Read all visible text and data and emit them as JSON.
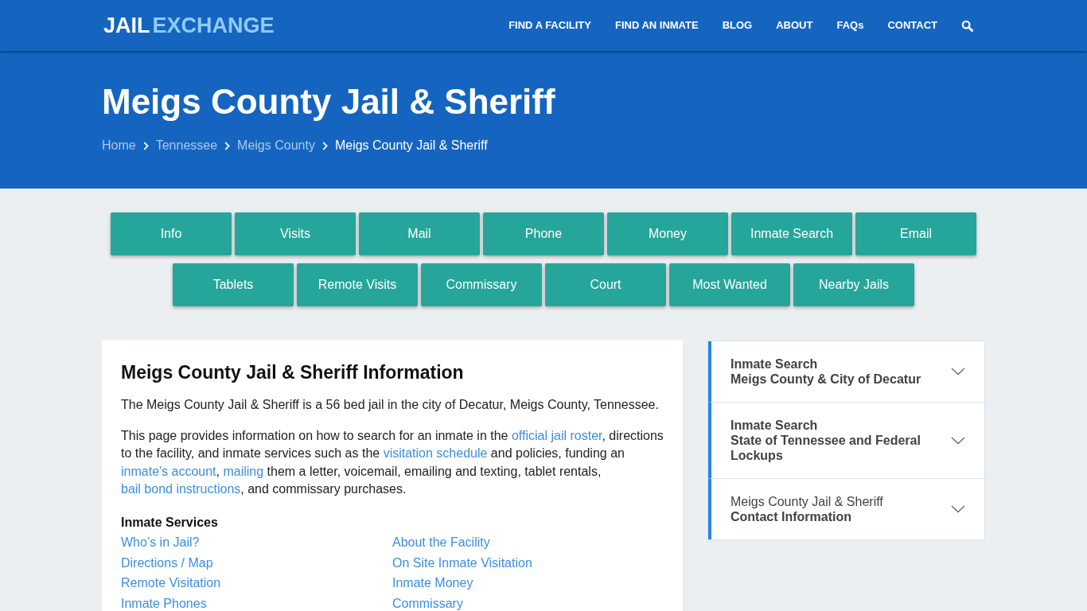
{
  "header": {
    "logo": {
      "part_1": "JAIL",
      "part_2": "EXCHANGE"
    },
    "nav": [
      "FIND A FACILITY",
      "FIND AN INMATE",
      "BLOG",
      "ABOUT",
      "FAQs",
      "CONTACT"
    ]
  },
  "hero": {
    "title": "Meigs County Jail & Sheriff",
    "breadcrumb": [
      {
        "label": "Home",
        "current": false
      },
      {
        "label": "Tennessee",
        "current": false
      },
      {
        "label": "Meigs County",
        "current": false
      },
      {
        "label": "Meigs County Jail & Sheriff",
        "current": true
      }
    ]
  },
  "section_buttons": [
    {
      "buttons": [
        "Info",
        "Visits",
        "Mail",
        "Phone",
        "Money",
        "Inmate Search",
        "Email"
      ]
    },
    {
      "buttons": [
        "Tablets",
        "Remote Visits",
        "Commissary",
        "Court",
        "Most Wanted",
        "Nearby Jails"
      ]
    }
  ],
  "info_card": {
    "heading": "Meigs County Jail & Sheriff Information",
    "paragraphs": [
      [
        {
          "kind": "text",
          "text": "The Meigs County Jail & Sheriff is a 56 bed jail in the city of Decatur, Meigs County, Tennessee."
        }
      ],
      [
        {
          "kind": "text",
          "text": "This page provides information on how to search for an inmate in the "
        },
        {
          "kind": "link",
          "text": "official jail roster"
        },
        {
          "kind": "text",
          "text": ", directions to the facility, and inmate services such as the "
        },
        {
          "kind": "link",
          "text": "visitation schedule"
        },
        {
          "kind": "text",
          "text": " and policies, funding an "
        },
        {
          "kind": "link",
          "text": "inmate's account"
        },
        {
          "kind": "text",
          "text": ", "
        },
        {
          "kind": "link",
          "text": "mailing"
        },
        {
          "kind": "text",
          "text": " them a letter, voicemail, emailing and texting, tablet rentals, "
        },
        {
          "kind": "link",
          "text": "bail bond instructions"
        },
        {
          "kind": "text",
          "text": ", and commissary purchases."
        }
      ]
    ],
    "services": {
      "heading": "Inmate Services",
      "columns": [
        [
          "Who’s in Jail?",
          "Directions / Map",
          "Remote Visitation",
          "Inmate Phones"
        ],
        [
          "About the Facility",
          "On Site Inmate Visitation",
          "Inmate Money",
          "Commissary"
        ]
      ]
    }
  },
  "sidebar": {
    "items": [
      {
        "lines": [
          {
            "text": "Inmate Search",
            "bold": true
          },
          {
            "text": "Meigs County & City of Decatur",
            "bold": true
          }
        ],
        "expanded": false
      },
      {
        "lines": [
          {
            "text": "Inmate Search",
            "bold": true
          },
          {
            "text": "State of Tennessee and Federal Lockups",
            "bold": true
          }
        ],
        "expanded": false
      },
      {
        "lines": [
          {
            "text": "Meigs County Jail & Sheriff",
            "bold": false
          },
          {
            "text": "Contact Information",
            "bold": true
          }
        ],
        "expanded": false
      }
    ]
  }
}
